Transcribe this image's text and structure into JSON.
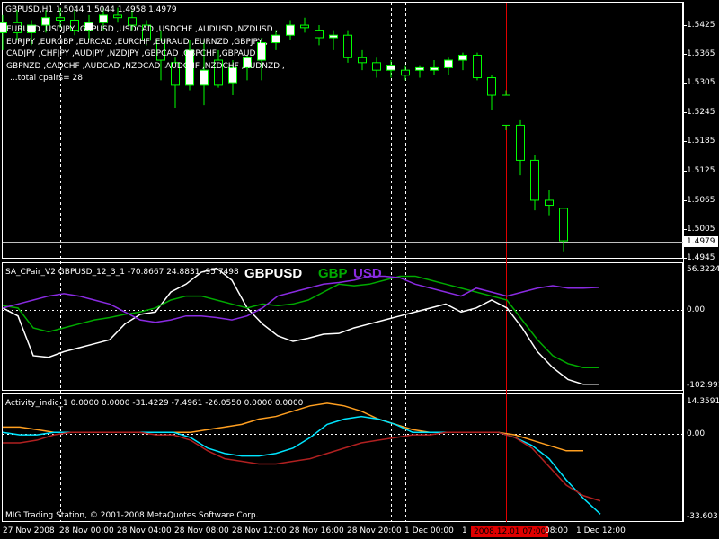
{
  "window": {
    "symbol_title": "GBPUSD,H1  1.5044 1.5044 1.4958 1.4979",
    "copyright": "MIG Trading Station, © 2001-2008 MetaQuotes Software Corp."
  },
  "main": {
    "pairs_lines": [
      "EURUSD ,USDJPY ,GBPUSD ,USDCAD ,USDCHF ,AUDUSD ,NZDUSD ,",
      "EURJPY ,EURGBP ,EURCAD ,EURCHF ,EURAUD ,EURNZD ,GBPJPY ,",
      "CADJPY ,CHFJPY ,AUDJPY ,NZDJPY ,GBPCAD ,GBPCHF ,GBPAUD ,",
      "GBPNZD ,CADCHF ,AUDCAD ,NZDCAD ,AUDCHF ,NZDCHF ,AUDNZD ,"
    ],
    "total_pairs": "...total cpairs= 28",
    "price_labels": [
      "1.5425",
      "1.5365",
      "1.5305",
      "1.5245",
      "1.5185",
      "1.5125",
      "1.5065",
      "1.5005",
      "1.4945"
    ],
    "current_price": "1.4979",
    "candle_colors": {
      "bull": "#ffffff",
      "bear": "#000000",
      "wick": "#00ff00"
    }
  },
  "indicator1": {
    "header": "SA_CPair_V2 GBPUSD_12_3_1 -70.8667 24.8831 -95.7498",
    "legend_pair": "GBPUSD",
    "legend_base": "GBP",
    "legend_quote": "USD",
    "scale_top": "56.3224",
    "scale_zero": "0.00",
    "scale_bottom": "-102.9917",
    "colors": {
      "pair": "#ffffff",
      "base": "#00aa00",
      "quote": "#8a2be2"
    }
  },
  "indicator2": {
    "header": "Activity_indic_1 0.0000 0.0000 -31.4229 -7.4961 -26.0550 0.0000 0.0000",
    "scale_top": "14.3591",
    "scale_zero": "0.00",
    "scale_bottom": "-33.603",
    "colors": {
      "orange": "#ff9f20",
      "cyan": "#00e5ff",
      "red": "#b02020"
    }
  },
  "time_axis": {
    "labels": [
      "27 Nov 2008",
      "28 Nov 00:00",
      "28 Nov 04:00",
      "28 Nov 08:00",
      "28 Nov 12:00",
      "28 Nov 16:00",
      "28 Nov 20:00",
      "1 Dec 00:00",
      "1",
      "08:00",
      "1 Dec 12:00"
    ],
    "cursor_label": "2008.12.01 07:00"
  },
  "chart_data": [
    {
      "type": "candlestick",
      "title": "GBPUSD,H1",
      "ylim": [
        1.4945,
        1.5455
      ],
      "candles": [
        {
          "o": 1.5395,
          "h": 1.543,
          "l": 1.536,
          "c": 1.5415
        },
        {
          "o": 1.5415,
          "h": 1.544,
          "l": 1.538,
          "c": 1.5395
        },
        {
          "o": 1.5395,
          "h": 1.542,
          "l": 1.537,
          "c": 1.541
        },
        {
          "o": 1.541,
          "h": 1.544,
          "l": 1.5395,
          "c": 1.5425
        },
        {
          "o": 1.5425,
          "h": 1.5445,
          "l": 1.5405,
          "c": 1.542
        },
        {
          "o": 1.542,
          "h": 1.544,
          "l": 1.539,
          "c": 1.54
        },
        {
          "o": 1.54,
          "h": 1.543,
          "l": 1.538,
          "c": 1.5415
        },
        {
          "o": 1.5415,
          "h": 1.5445,
          "l": 1.54,
          "c": 1.543
        },
        {
          "o": 1.543,
          "h": 1.5445,
          "l": 1.5415,
          "c": 1.5425
        },
        {
          "o": 1.5425,
          "h": 1.544,
          "l": 1.54,
          "c": 1.541
        },
        {
          "o": 1.541,
          "h": 1.542,
          "l": 1.537,
          "c": 1.538
        },
        {
          "o": 1.538,
          "h": 1.54,
          "l": 1.53,
          "c": 1.534
        },
        {
          "o": 1.5335,
          "h": 1.5345,
          "l": 1.5245,
          "c": 1.529
        },
        {
          "o": 1.529,
          "h": 1.538,
          "l": 1.528,
          "c": 1.536
        },
        {
          "o": 1.529,
          "h": 1.538,
          "l": 1.525,
          "c": 1.532
        },
        {
          "o": 1.534,
          "h": 1.536,
          "l": 1.5285,
          "c": 1.529
        },
        {
          "o": 1.5295,
          "h": 1.534,
          "l": 1.527,
          "c": 1.5325
        },
        {
          "o": 1.5325,
          "h": 1.535,
          "l": 1.53,
          "c": 1.5345
        },
        {
          "o": 1.534,
          "h": 1.5385,
          "l": 1.53,
          "c": 1.5375
        },
        {
          "o": 1.5375,
          "h": 1.54,
          "l": 1.536,
          "c": 1.539
        },
        {
          "o": 1.539,
          "h": 1.542,
          "l": 1.538,
          "c": 1.541
        },
        {
          "o": 1.541,
          "h": 1.5425,
          "l": 1.5395,
          "c": 1.5405
        },
        {
          "o": 1.54,
          "h": 1.541,
          "l": 1.537,
          "c": 1.5385
        },
        {
          "o": 1.5385,
          "h": 1.54,
          "l": 1.536,
          "c": 1.539
        },
        {
          "o": 1.539,
          "h": 1.54,
          "l": 1.5335,
          "c": 1.5345
        },
        {
          "o": 1.5345,
          "h": 1.536,
          "l": 1.532,
          "c": 1.5335
        },
        {
          "o": 1.5335,
          "h": 1.5345,
          "l": 1.5305,
          "c": 1.532
        },
        {
          "o": 1.532,
          "h": 1.534,
          "l": 1.5305,
          "c": 1.533
        },
        {
          "o": 1.532,
          "h": 1.533,
          "l": 1.53,
          "c": 1.531
        },
        {
          "o": 1.532,
          "h": 1.533,
          "l": 1.5305,
          "c": 1.5325
        },
        {
          "o": 1.532,
          "h": 1.534,
          "l": 1.531,
          "c": 1.5325
        },
        {
          "o": 1.5325,
          "h": 1.5345,
          "l": 1.531,
          "c": 1.534
        },
        {
          "o": 1.534,
          "h": 1.5355,
          "l": 1.532,
          "c": 1.535
        },
        {
          "o": 1.535,
          "h": 1.5355,
          "l": 1.53,
          "c": 1.5305
        },
        {
          "o": 1.5305,
          "h": 1.531,
          "l": 1.524,
          "c": 1.527
        },
        {
          "o": 1.527,
          "h": 1.528,
          "l": 1.52,
          "c": 1.521
        },
        {
          "o": 1.521,
          "h": 1.522,
          "l": 1.511,
          "c": 1.514
        },
        {
          "o": 1.514,
          "h": 1.515,
          "l": 1.504,
          "c": 1.506
        },
        {
          "o": 1.506,
          "h": 1.508,
          "l": 1.503,
          "c": 1.505
        },
        {
          "o": 1.5044,
          "h": 1.5044,
          "l": 1.4958,
          "c": 1.4979
        }
      ]
    },
    {
      "type": "line",
      "title": "SA_CPair_V2 GBPUSD_12_3_1",
      "ylim": [
        -102.9917,
        56.3224
      ],
      "series": [
        {
          "name": "GBPUSD",
          "values": [
            0,
            -10,
            -60,
            -62,
            -55,
            -50,
            -45,
            -40,
            -20,
            -8,
            -5,
            20,
            30,
            45,
            50,
            35,
            0,
            -20,
            -35,
            -42,
            -38,
            -33,
            -32,
            -25,
            -20,
            -15,
            -10,
            -5,
            0,
            5,
            -5,
            0,
            10,
            0,
            -25,
            -55,
            -75,
            -90,
            -96,
            -96
          ]
        },
        {
          "name": "GBP",
          "values": [
            3,
            0,
            -25,
            -30,
            -25,
            -20,
            -15,
            -12,
            -8,
            -5,
            0,
            10,
            15,
            15,
            10,
            5,
            0,
            5,
            3,
            5,
            10,
            20,
            30,
            28,
            30,
            35,
            40,
            40,
            35,
            30,
            25,
            20,
            15,
            10,
            -15,
            -40,
            -60,
            -70,
            -75,
            -75
          ]
        },
        {
          "name": "USD",
          "values": [
            0,
            5,
            10,
            15,
            18,
            15,
            10,
            5,
            -5,
            -15,
            -18,
            -15,
            -10,
            -10,
            -12,
            -15,
            -10,
            0,
            15,
            20,
            25,
            30,
            32,
            35,
            40,
            40,
            38,
            30,
            25,
            20,
            15,
            25,
            20,
            15,
            20,
            25,
            28,
            25,
            25,
            26
          ]
        }
      ]
    },
    {
      "type": "line",
      "title": "Activity_indic_1",
      "ylim": [
        -33.603,
        14.3591
      ],
      "series": [
        {
          "name": "",
          "values": [
            2,
            2,
            1,
            0,
            0,
            0,
            0,
            0,
            0,
            0,
            0,
            0,
            1,
            2,
            3,
            5,
            6,
            8,
            10,
            11,
            10,
            8,
            5,
            3,
            1,
            0,
            0,
            0,
            0,
            0,
            -1,
            -3,
            -5,
            -7,
            -7
          ]
        },
        {
          "name": "",
          "values": [
            0,
            -1,
            -1,
            0,
            0,
            0,
            0,
            0,
            0,
            0,
            0,
            -2,
            -6,
            -8,
            -9,
            -9,
            -8,
            -6,
            -2,
            3,
            5,
            6,
            5,
            3,
            0,
            0,
            0,
            0,
            0,
            0,
            -2,
            -5,
            -10,
            -18,
            -25,
            -31
          ]
        },
        {
          "name": "",
          "values": [
            -4,
            -4,
            -3,
            -1,
            0,
            0,
            0,
            0,
            0,
            -1,
            -1,
            -3,
            -7,
            -10,
            -11,
            -12,
            -12,
            -11,
            -10,
            -8,
            -6,
            -4,
            -3,
            -2,
            -1,
            -1,
            0,
            0,
            0,
            0,
            -2,
            -6,
            -13,
            -20,
            -24,
            -26
          ]
        }
      ]
    }
  ]
}
